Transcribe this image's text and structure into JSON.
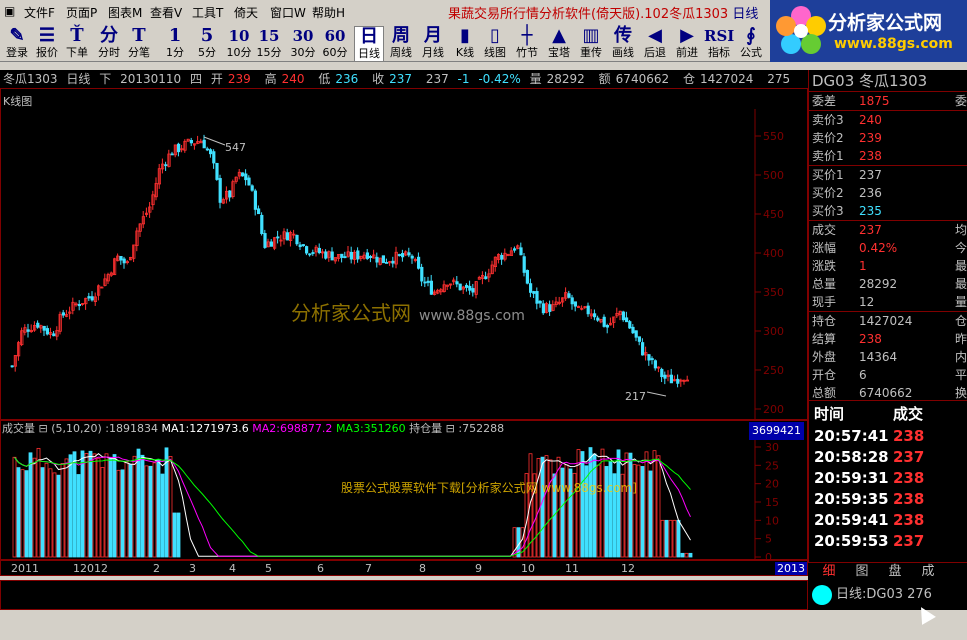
{
  "menu": {
    "items": [
      "文件F",
      "页面P",
      "图表M",
      "查看V",
      "工具T",
      "倚天",
      "窗口W",
      "帮助H"
    ],
    "app_title": "果蔬交易所行情分析软件(倚天版).102冬瓜1303",
    "extra": "日线"
  },
  "logo": {
    "text": "分析家公式网",
    "url": "www.88gs.com"
  },
  "toolbar": [
    {
      "icon": "✎",
      "label": "登录"
    },
    {
      "icon": "☰",
      "label": "报价"
    },
    {
      "icon": "Ť",
      "label": "下单"
    },
    {
      "icon": "分",
      "label": "分时"
    },
    {
      "icon": "T",
      "label": "分笔"
    },
    {
      "icon": "1",
      "label": "1分"
    },
    {
      "icon": "5",
      "label": "5分"
    },
    {
      "icon": "10",
      "label": "10分"
    },
    {
      "icon": "15",
      "label": "15分"
    },
    {
      "icon": "30",
      "label": "30分"
    },
    {
      "icon": "60",
      "label": "60分"
    },
    {
      "icon": "日",
      "label": "日线"
    },
    {
      "icon": "周",
      "label": "周线"
    },
    {
      "icon": "月",
      "label": "月线"
    },
    {
      "icon": "▮",
      "label": "K线"
    },
    {
      "icon": "▯",
      "label": "线图"
    },
    {
      "icon": "┼",
      "label": "竹节"
    },
    {
      "icon": "▲",
      "label": "宝塔"
    },
    {
      "icon": "▥",
      "label": "重传"
    },
    {
      "icon": "传",
      "label": "画线"
    },
    {
      "icon": "◀",
      "label": "后退"
    },
    {
      "icon": "▶",
      "label": "前进"
    },
    {
      "icon": "RSI",
      "label": "指标"
    },
    {
      "icon": "∮",
      "label": "公式"
    }
  ],
  "infobar": {
    "name": "冬瓜1303",
    "period": "日线",
    "dir": "下",
    "date": "20130110",
    "weekday": "四",
    "open_l": "开",
    "open": "239",
    "high_l": "高",
    "high": "240",
    "low_l": "低",
    "low": "236",
    "close_l": "收",
    "close": "237",
    "last": "237",
    "chg": "-1",
    "pct": "-0.42%",
    "vol_l": "量",
    "vol": "28292",
    "amt_l": "额",
    "amt": "6740662",
    "oi_l": "仓",
    "oi": "1427024",
    "tail": "275"
  },
  "kline": {
    "label": "K线图",
    "price_ticks": [
      "550",
      "500",
      "450",
      "400",
      "350",
      "300",
      "250",
      "200"
    ],
    "high_label": "547",
    "low_label": "217",
    "watermark": "分析家公式网",
    "watermark_url": "www.88gs.com"
  },
  "volume": {
    "title": "成交量",
    "params": "(5,10,20)",
    "value": ":1891834",
    "ma1": "MA1:1271973.6",
    "ma2": "MA2:698877.2",
    "ma3": "MA3:351260",
    "oi_title": "持仓量",
    "oi_value": ":752288",
    "max": "3699421",
    "ticks": [
      "30",
      "25",
      "20",
      "15",
      "10",
      "5",
      "0"
    ],
    "watermark": "股票公式股票软件下载[分析家公式网 www.88gs.com]"
  },
  "xaxis": {
    "labels": [
      "2011",
      "12012",
      "2",
      "3",
      "4",
      "5",
      "6",
      "7",
      "8",
      "9",
      "10",
      "11",
      "12",
      "2013"
    ],
    "year": "2013"
  },
  "quote": {
    "title": "DG03 冬瓜1303",
    "weibi_l": "委差",
    "weibi": "1875",
    "weibi_r": "委",
    "asks": [
      {
        "l": "卖价3",
        "v": "240"
      },
      {
        "l": "卖价2",
        "v": "239"
      },
      {
        "l": "卖价1",
        "v": "238"
      }
    ],
    "bids": [
      {
        "l": "买价1",
        "v": "237"
      },
      {
        "l": "买价2",
        "v": "236"
      },
      {
        "l": "买价3",
        "v": "235"
      }
    ],
    "rows1": [
      {
        "l": "成交",
        "v": "237",
        "r": "均",
        "c": "#ff3030"
      },
      {
        "l": "涨幅",
        "v": "0.42%",
        "r": "今",
        "c": "#ff3030"
      },
      {
        "l": "涨跌",
        "v": "1",
        "r": "最",
        "c": "#ff3030"
      },
      {
        "l": "总量",
        "v": "28292",
        "r": "最",
        "c": "#c0c0c0"
      },
      {
        "l": "现手",
        "v": "12",
        "r": "量",
        "c": "#c0c0c0"
      }
    ],
    "rows2": [
      {
        "l": "持仓",
        "v": "1427024",
        "r": "仓",
        "c": "#c0c0c0"
      },
      {
        "l": "结算",
        "v": "238",
        "r": "昨",
        "c": "#ff3030"
      },
      {
        "l": "外盘",
        "v": "14364",
        "r": "内",
        "c": "#c0c0c0"
      },
      {
        "l": "开仓",
        "v": "6",
        "r": "平",
        "c": "#c0c0c0"
      },
      {
        "l": "总额",
        "v": "6740662",
        "r": "换",
        "c": "#c0c0c0"
      }
    ],
    "trade_head_time": "时间",
    "trade_head_vol": "成交",
    "trades": [
      {
        "t": "20:57:41",
        "p": "238"
      },
      {
        "t": "20:58:28",
        "p": "237"
      },
      {
        "t": "20:59:31",
        "p": "238"
      },
      {
        "t": "20:59:35",
        "p": "238"
      },
      {
        "t": "20:59:41",
        "p": "238"
      },
      {
        "t": "20:59:53",
        "p": "237"
      }
    ],
    "tabs": [
      "细",
      "图",
      "盘",
      "成"
    ],
    "status": "日线:DG03 276"
  },
  "colors": {
    "up": "#ff3030",
    "down": "#40e0ff",
    "ma1": "#ffffff",
    "ma2": "#ff00ff",
    "ma3": "#00ff00",
    "grid": "#800000"
  }
}
